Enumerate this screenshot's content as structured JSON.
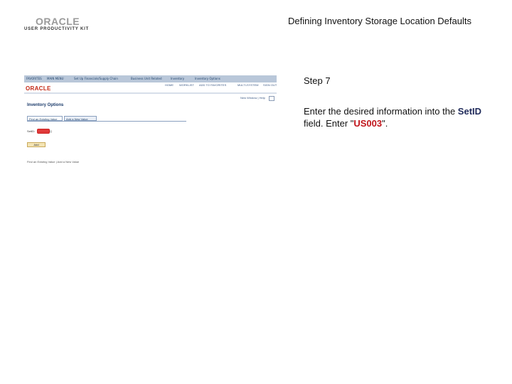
{
  "header": {
    "logo_brand": "ORACLE",
    "logo_kit": "USER PRODUCTIVITY KIT",
    "title": "Defining Inventory Storage Location Defaults"
  },
  "screenshot": {
    "topnav": [
      "FAVORITES",
      "MAIN MENU",
      "Set Up Financials/Supply Chain",
      "Business Unit Related",
      "Inventory",
      "Inventory Options"
    ],
    "brand": "ORACLE",
    "links": [
      "HOME",
      "WORKLIST",
      "ADD TO FAVORITES",
      "MULTI-SYSTEM",
      "SIGN OUT"
    ],
    "new_window": "New Window | Help",
    "page_title": "Inventory Options",
    "tabs": [
      "Find an Existing Value",
      "Add a New Value"
    ],
    "setid_label": "SetID:",
    "lookup": "Q",
    "add_button": "Add",
    "footer_links": "Find an Existing Value | Add a New Value"
  },
  "instructions": {
    "step": "Step 7",
    "text_before": "Enter the desired information into the ",
    "field_name": "SetID",
    "text_middle": " field. Enter \"",
    "value": "US003",
    "text_after": "\"."
  },
  "colors": {
    "field_highlight": "#1f2a5a",
    "value_highlight": "#c0151b",
    "oracle_red": "#c42a17"
  }
}
